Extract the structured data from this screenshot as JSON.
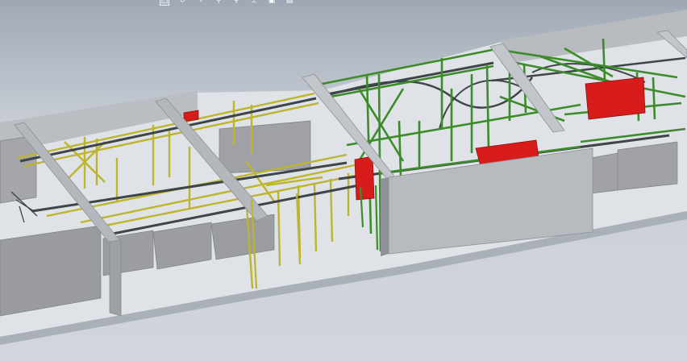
{
  "toolbar": {
    "icons": [
      "select-box-icon",
      "rotate-view-icon",
      "pan-view-icon",
      "zoom-in-icon",
      "zoom-fit-icon",
      "section-view-icon",
      "display-style-icon",
      "standard-views-icon"
    ]
  },
  "colors": {
    "background": "#c6ccd4",
    "floor": "#dfe2e7",
    "wall": "#b9bcc1",
    "wall_shadow": "#8e9197",
    "machine": "#a2a4a8",
    "yellow_frame": "#bdb52c",
    "green_frame": "#3c8c2a",
    "conveyor_track": "#3e4548",
    "red_unit": "#d81c1c"
  }
}
